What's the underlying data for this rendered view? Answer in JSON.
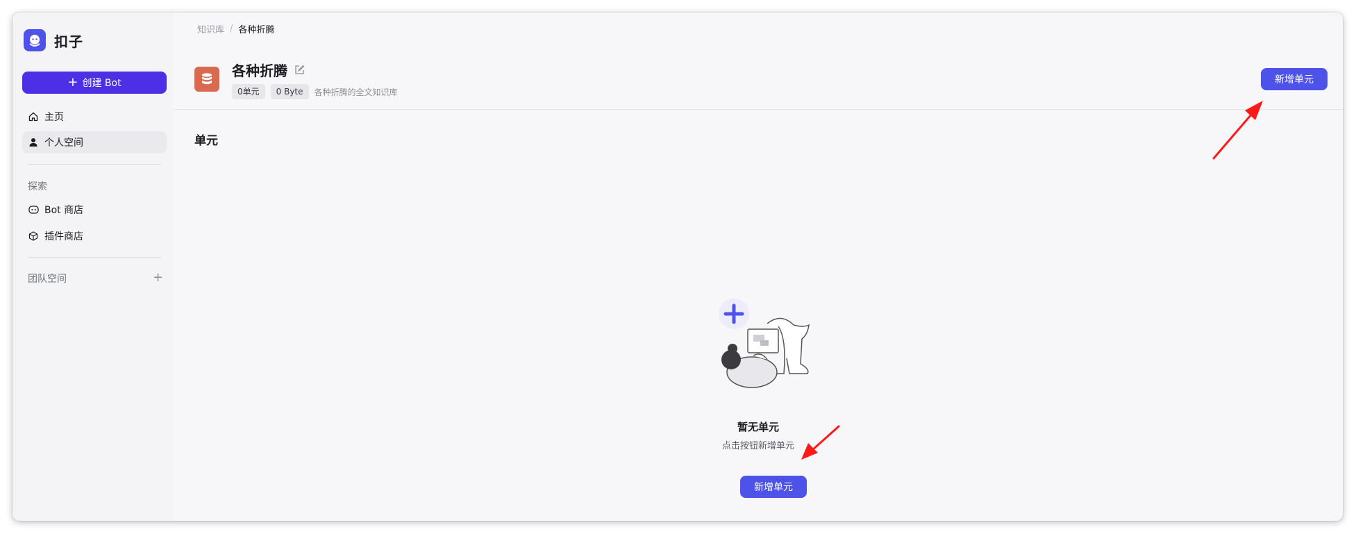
{
  "app": {
    "name": "扣子"
  },
  "sidebar": {
    "create_button": "创建 Bot",
    "nav": [
      {
        "label": "主页",
        "icon": "home-icon"
      },
      {
        "label": "个人空间",
        "icon": "user-icon",
        "active": true
      }
    ],
    "explore_label": "探索",
    "explore": [
      {
        "label": "Bot 商店",
        "icon": "bot-icon"
      },
      {
        "label": "插件商店",
        "icon": "cube-icon"
      }
    ],
    "team_label": "团队空间"
  },
  "breadcrumb": {
    "root": "知识库",
    "separator": "/",
    "current": "各种折腾"
  },
  "knowledge": {
    "title": "各种折腾",
    "unit_count": "0单元",
    "size": "0 Byte",
    "description": "各种折腾的全文知识库",
    "add_unit_button": "新增单元"
  },
  "units": {
    "section_title": "单元",
    "empty_title": "暂无单元",
    "empty_desc": "点击按钮新增单元",
    "empty_button": "新增单元"
  },
  "colors": {
    "accent": "#4d53e8",
    "create_button": "#4d2fe6",
    "kb_icon": "#d9694f",
    "annotation_arrow": "#ff1a1a"
  }
}
